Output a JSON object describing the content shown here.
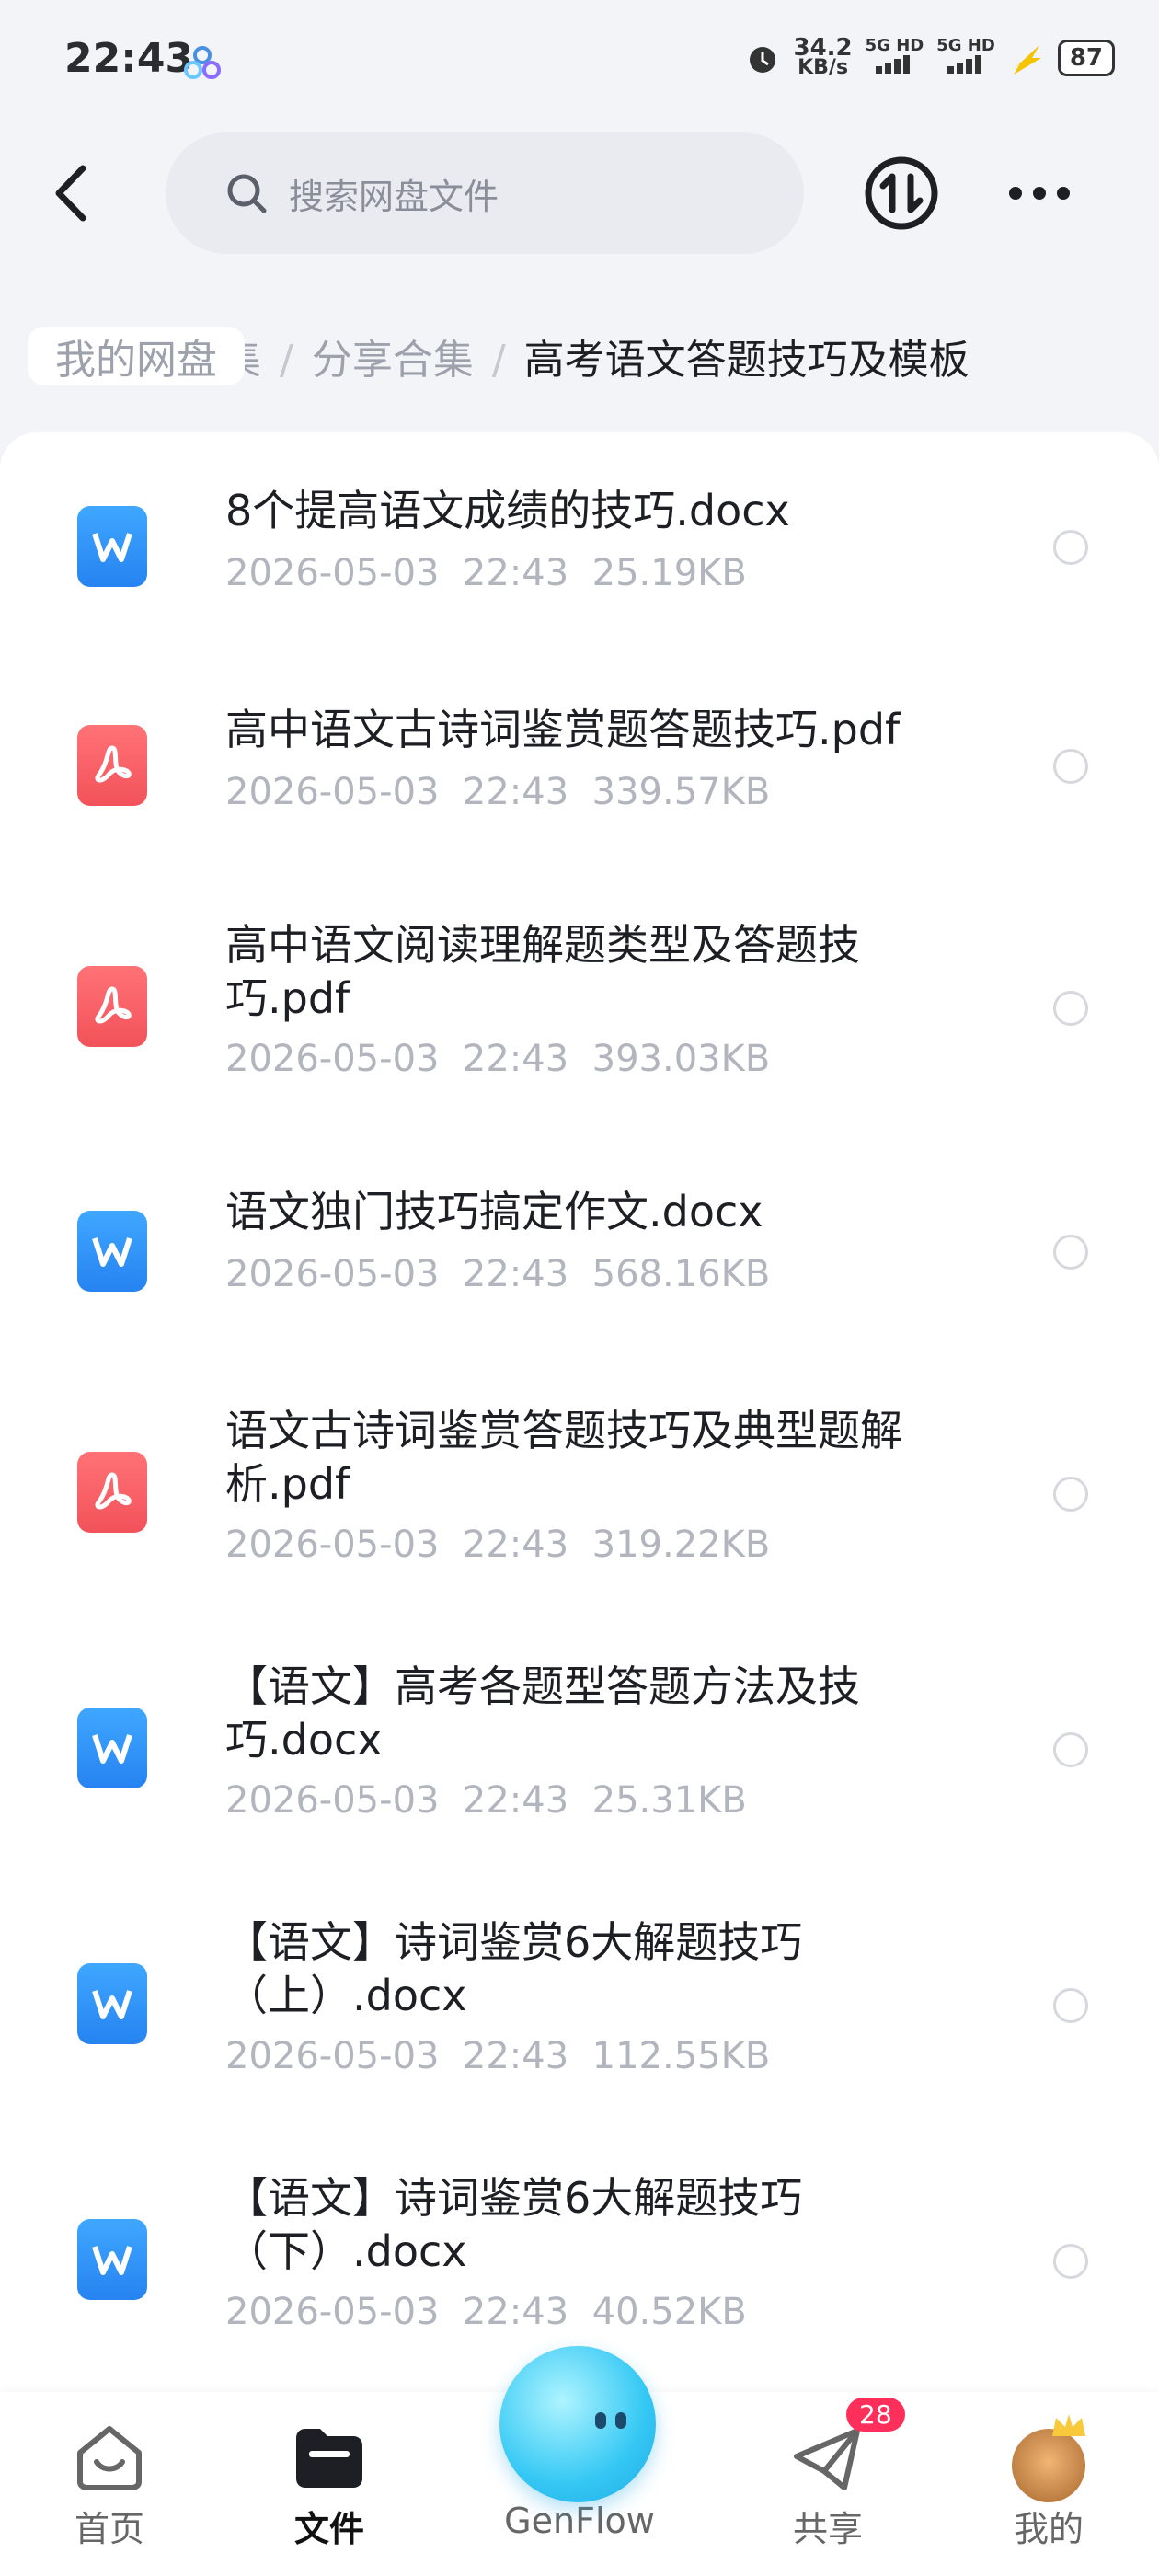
{
  "status": {
    "time": "22:43",
    "speed": "34.2",
    "speed_unit": "KB/s",
    "net1": "5G HD",
    "net2": "5G HD",
    "battery": "87"
  },
  "search": {
    "placeholder": "搜索网盘文件"
  },
  "breadcrumb": {
    "first": "我的网盘",
    "hidden": "合集",
    "second": "分享合集",
    "current": "高考语文答题技巧及模板",
    "separator": "/"
  },
  "files": [
    {
      "type": "word",
      "name": "8个提高语文成绩的技巧.docx",
      "date": "2026-05-03",
      "time": "22:43",
      "size": "25.19KB"
    },
    {
      "type": "pdf",
      "name": "高中语文古诗词鉴赏题答题技巧.pdf",
      "date": "2026-05-03",
      "time": "22:43",
      "size": "339.57KB"
    },
    {
      "type": "pdf",
      "name": "高中语文阅读理解题类型及答题技巧.pdf",
      "date": "2026-05-03",
      "time": "22:43",
      "size": "393.03KB"
    },
    {
      "type": "word",
      "name": "语文独门技巧搞定作文.docx",
      "date": "2026-05-03",
      "time": "22:43",
      "size": "568.16KB"
    },
    {
      "type": "pdf",
      "name": "语文古诗词鉴赏答题技巧及典型题解析.pdf",
      "date": "2026-05-03",
      "time": "22:43",
      "size": "319.22KB"
    },
    {
      "type": "word",
      "name": "【语文】高考各题型答题方法及技巧.docx",
      "date": "2026-05-03",
      "time": "22:43",
      "size": "25.31KB"
    },
    {
      "type": "word",
      "name": "【语文】诗词鉴赏6大解题技巧（上）.docx",
      "date": "2026-05-03",
      "time": "22:43",
      "size": "112.55KB"
    },
    {
      "type": "word",
      "name": "【语文】诗词鉴赏6大解题技巧（下）.docx",
      "date": "2026-05-03",
      "time": "22:43",
      "size": "40.52KB"
    }
  ],
  "tabs": {
    "home": "首页",
    "files": "文件",
    "genflow": "GenFlow",
    "share": "共享",
    "share_badge": "28",
    "mine": "我的"
  },
  "colors": {
    "word": "#2683f1",
    "pdf": "#f2525a",
    "badge": "#ff2f5c"
  }
}
